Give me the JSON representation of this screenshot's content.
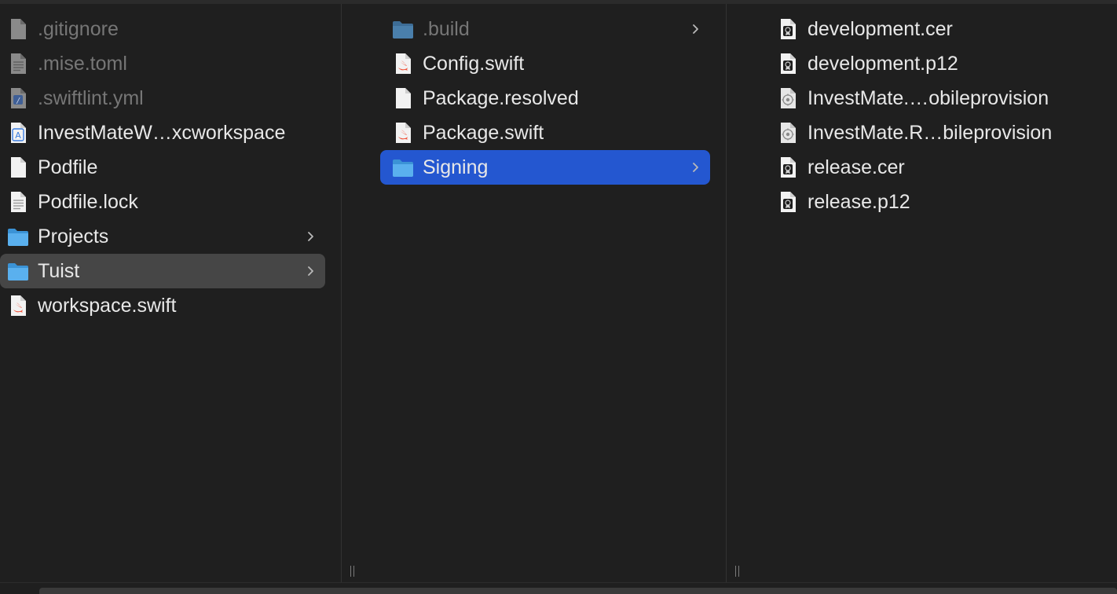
{
  "columns": [
    {
      "items": [
        {
          "label": ".gitignore",
          "icon": "document-icon",
          "hidden": true
        },
        {
          "label": ".mise.toml",
          "icon": "text-document-icon",
          "hidden": true
        },
        {
          "label": ".swiftlint.yml",
          "icon": "yaml-document-icon",
          "hidden": true
        },
        {
          "label": "InvestMateW…xcworkspace",
          "icon": "xcworkspace-icon"
        },
        {
          "label": "Podfile",
          "icon": "document-icon"
        },
        {
          "label": "Podfile.lock",
          "icon": "text-document-icon"
        },
        {
          "label": "Projects",
          "icon": "folder-icon",
          "has_children": true
        },
        {
          "label": "Tuist",
          "icon": "folder-icon",
          "has_children": true,
          "selected": "inactive"
        },
        {
          "label": "workspace.swift",
          "icon": "swift-file-icon"
        }
      ]
    },
    {
      "items": [
        {
          "label": ".build",
          "icon": "folder-icon",
          "hidden": true,
          "has_children": true
        },
        {
          "label": "Config.swift",
          "icon": "swift-file-icon"
        },
        {
          "label": "Package.resolved",
          "icon": "document-icon"
        },
        {
          "label": "Package.swift",
          "icon": "swift-file-icon"
        },
        {
          "label": "Signing",
          "icon": "folder-icon",
          "has_children": true,
          "selected": "active"
        }
      ]
    },
    {
      "items": [
        {
          "label": "development.cer",
          "icon": "certificate-icon"
        },
        {
          "label": "development.p12",
          "icon": "certificate-icon"
        },
        {
          "label": "InvestMate.…obileprovision",
          "icon": "provisioning-profile-icon"
        },
        {
          "label": "InvestMate.R…bileprovision",
          "icon": "provisioning-profile-icon"
        },
        {
          "label": "release.cer",
          "icon": "certificate-icon"
        },
        {
          "label": "release.p12",
          "icon": "certificate-icon"
        }
      ]
    }
  ],
  "colors": {
    "background": "#1f1f1f",
    "selection_active": "#2457d0",
    "selection_inactive": "#464646",
    "folder": "#4aa3e6",
    "swift": "#f05138"
  }
}
